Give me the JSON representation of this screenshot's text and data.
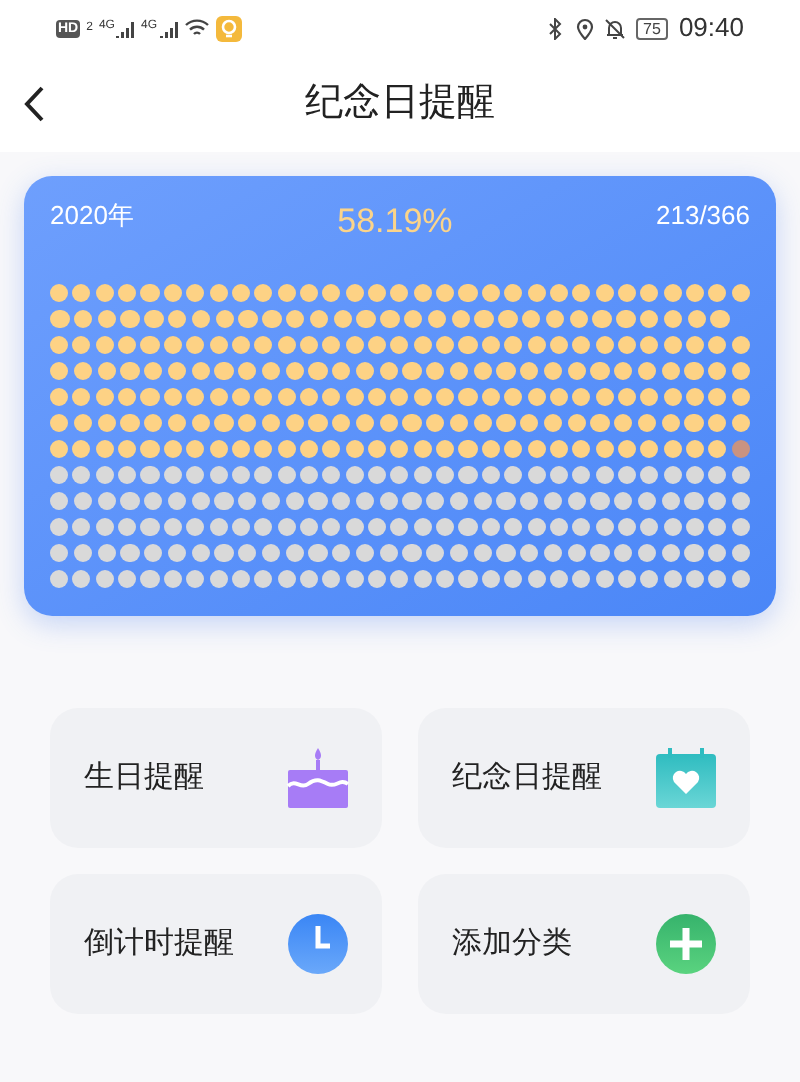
{
  "status_bar": {
    "hd": "HD",
    "sim": "2",
    "networks": [
      "4G",
      "4G"
    ],
    "battery": "75",
    "time": "09:40"
  },
  "header": {
    "title": "纪念日提醒"
  },
  "progress_card": {
    "year": "2020年",
    "percent": "58.19%",
    "count": "213/366",
    "months": [
      {
        "kind": "past"
      },
      {
        "kind": "past"
      },
      {
        "kind": "past"
      },
      {
        "kind": "past"
      },
      {
        "kind": "past"
      },
      {
        "kind": "past"
      },
      {
        "kind": "current"
      },
      {
        "kind": "future"
      },
      {
        "kind": "future"
      },
      {
        "kind": "future"
      },
      {
        "kind": "future"
      },
      {
        "kind": "future"
      }
    ]
  },
  "categories": [
    {
      "label": "生日提醒",
      "kind": "cake"
    },
    {
      "label": "纪念日提醒",
      "kind": "calendar"
    },
    {
      "label": "倒计时提醒",
      "kind": "clock"
    },
    {
      "label": "添加分类",
      "kind": "add"
    }
  ]
}
